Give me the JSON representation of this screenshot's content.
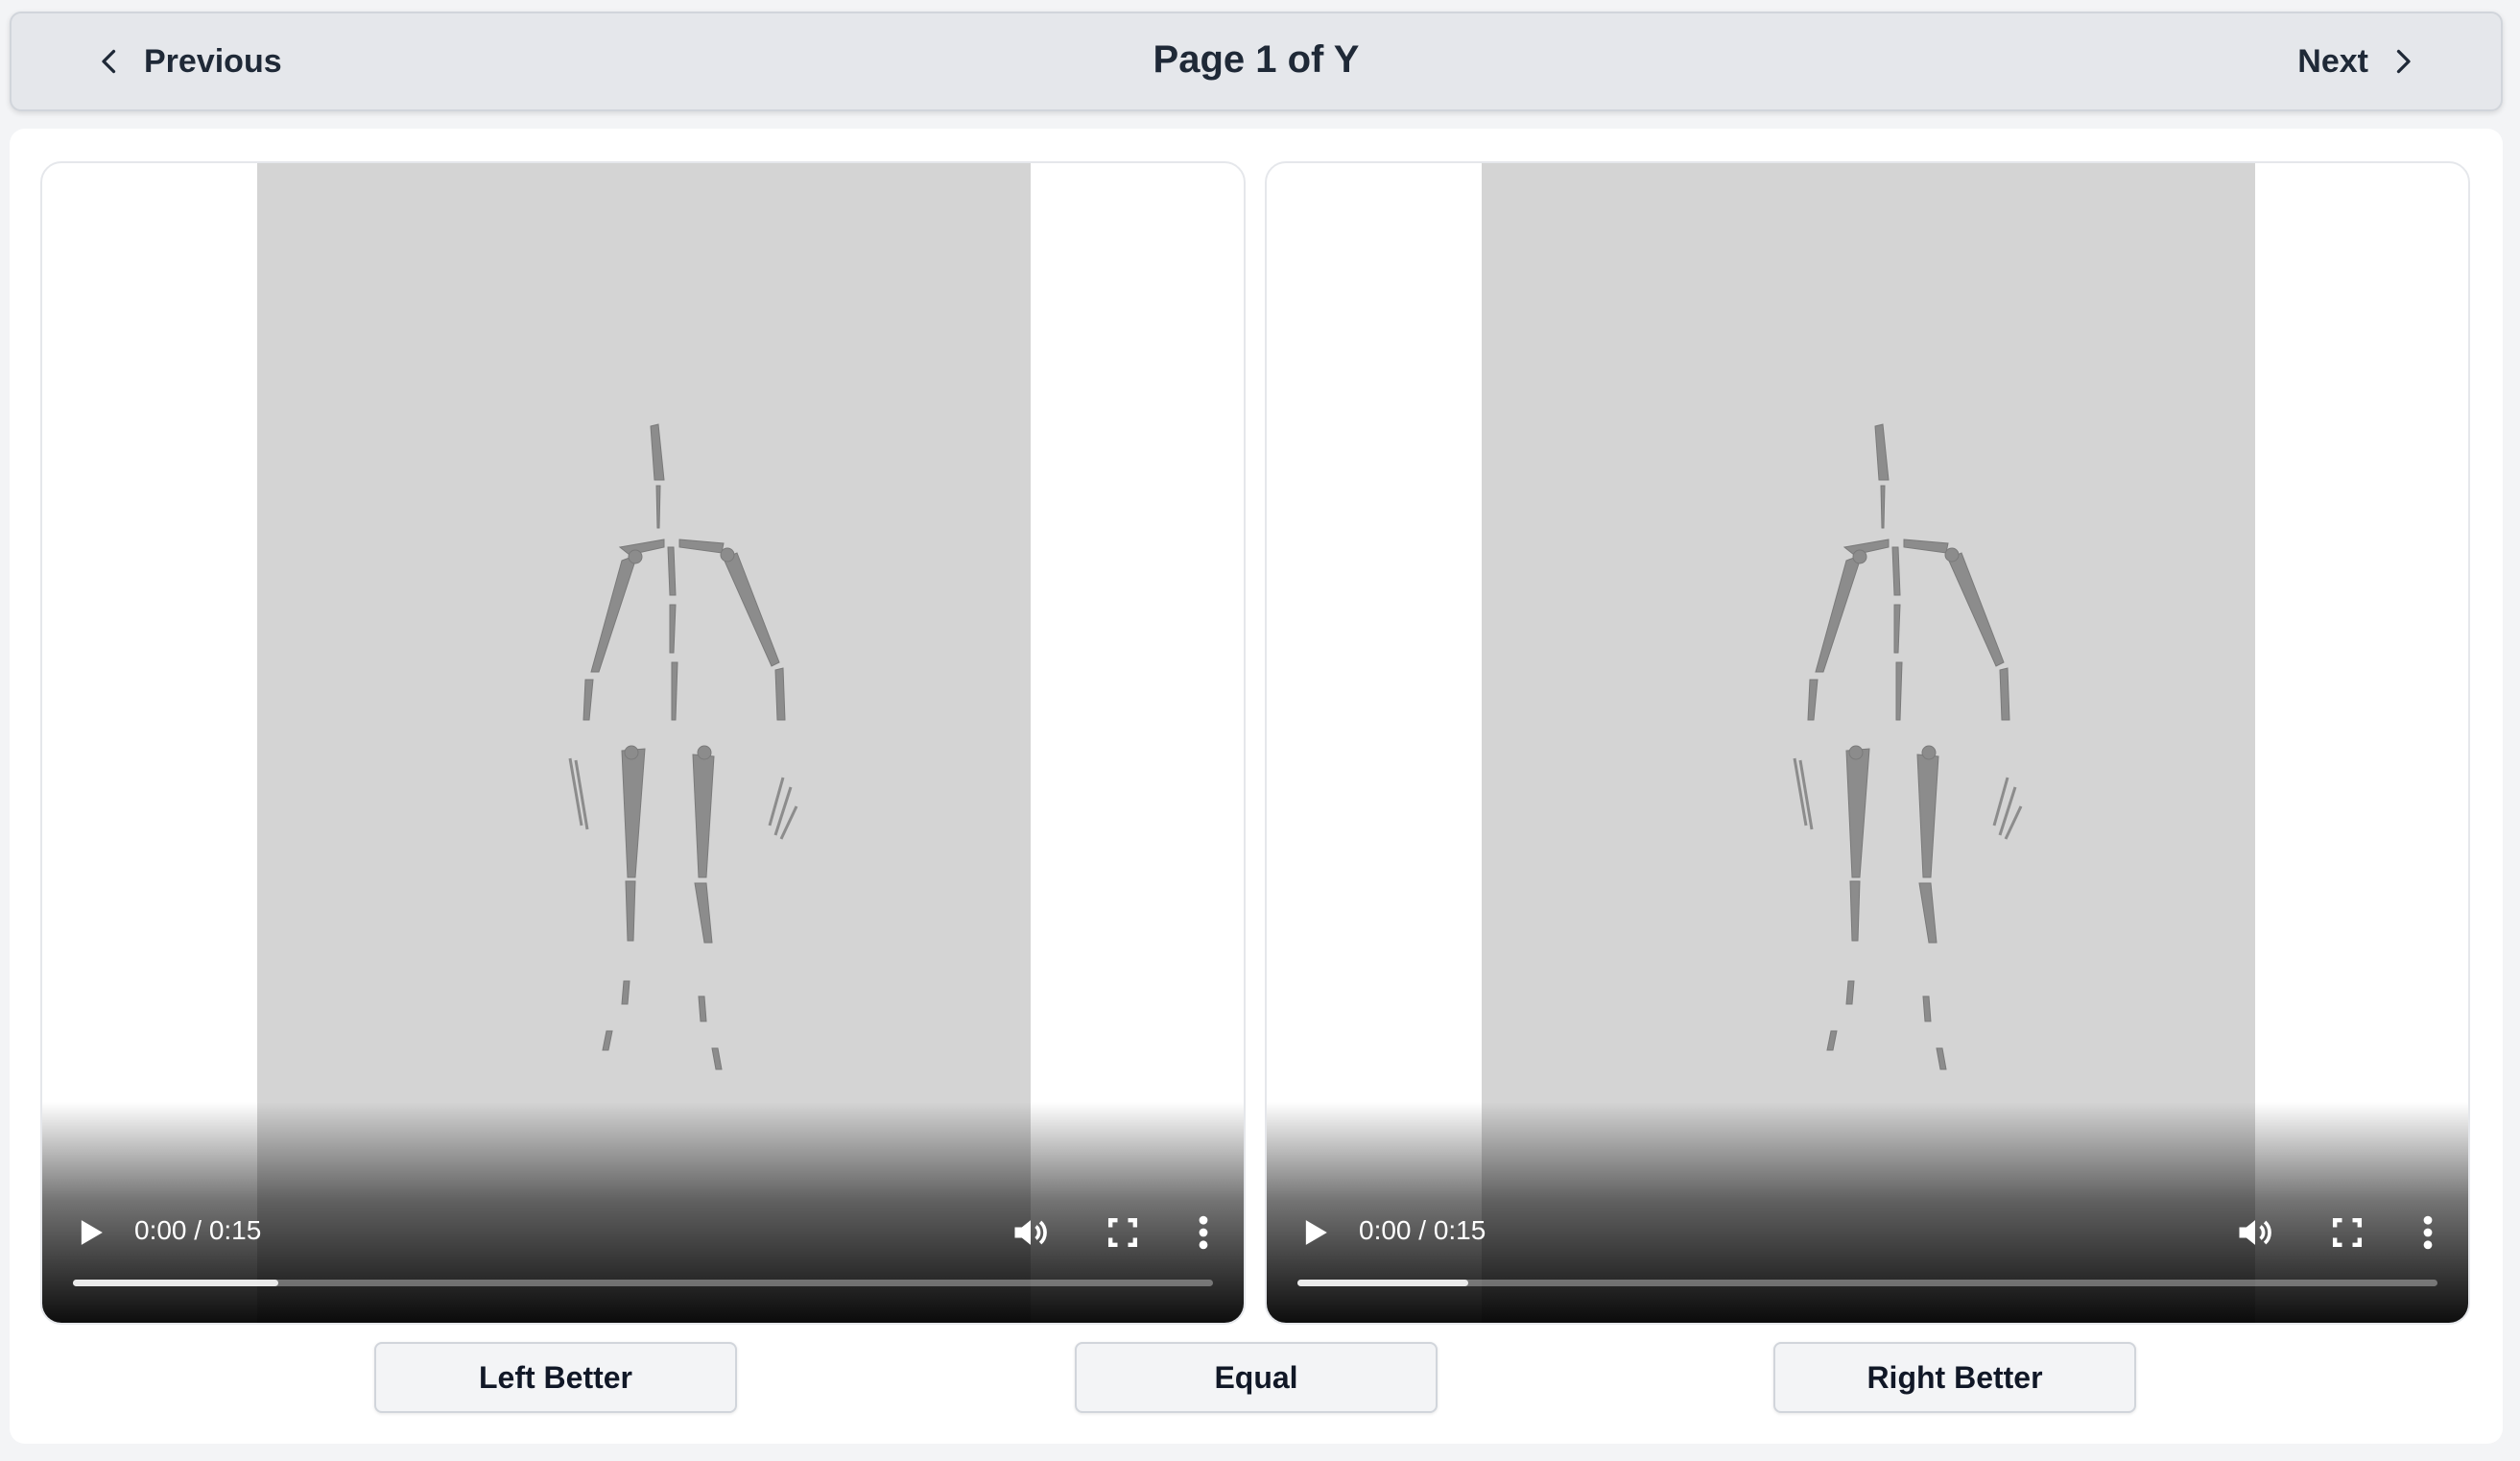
{
  "nav": {
    "previous_label": "Previous",
    "next_label": "Next",
    "page_title": "Page 1 of Y"
  },
  "videos": [
    {
      "id": "left",
      "time": "0:00 / 0:15",
      "progress": 0.18
    },
    {
      "id": "right",
      "time": "0:00 / 0:15",
      "progress": 0.15
    }
  ],
  "votes": {
    "left_label": "Left Better",
    "equal_label": "Equal",
    "right_label": "Right Better"
  },
  "icons": {
    "previous": "chevron-left-icon",
    "next": "chevron-right-icon",
    "play": "play-icon",
    "volume": "volume-icon",
    "fullscreen": "fullscreen-icon",
    "more": "more-vertical-icon"
  },
  "colors": {
    "frame": "#d4d4d4",
    "skeleton": "#8c8c8c",
    "topbar": "#e5e7eb"
  }
}
